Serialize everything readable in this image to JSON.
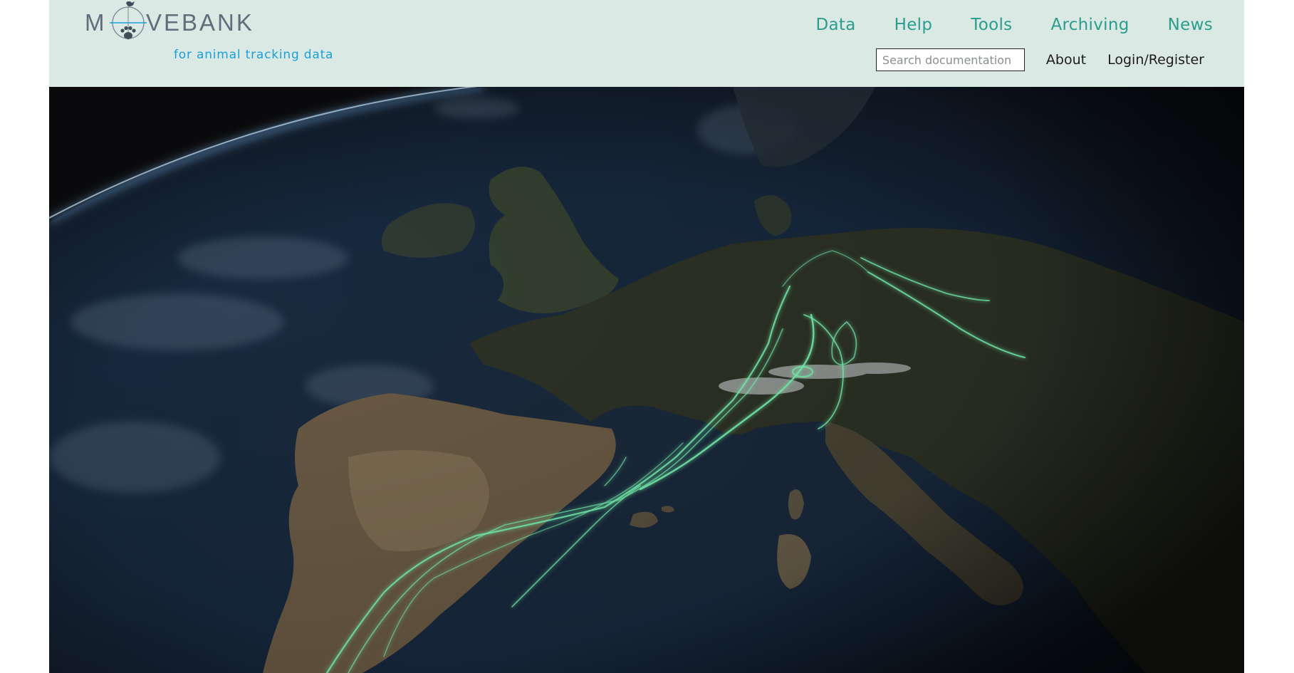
{
  "brand": {
    "name": "MOVEBANK",
    "tagline": "for animal tracking data"
  },
  "main_nav": [
    {
      "label": "Data"
    },
    {
      "label": "Help"
    },
    {
      "label": "Tools"
    },
    {
      "label": "Archiving"
    },
    {
      "label": "News"
    }
  ],
  "search": {
    "placeholder": "Search documentation",
    "value": ""
  },
  "sub_nav": [
    {
      "label": "About"
    },
    {
      "label": "Login/Register"
    }
  ],
  "hero": {
    "image": "satellite view of Europe with green animal migration tracks"
  },
  "colors": {
    "header_bg": "#dbe9e5",
    "nav_link": "#2a9d8c",
    "tagline": "#1aa0d8",
    "logo_gray": "#5f6e7a",
    "track_green": "#6fe3a4"
  },
  "icons": {
    "logo_mark": "paw-print-crosshair-icon"
  }
}
